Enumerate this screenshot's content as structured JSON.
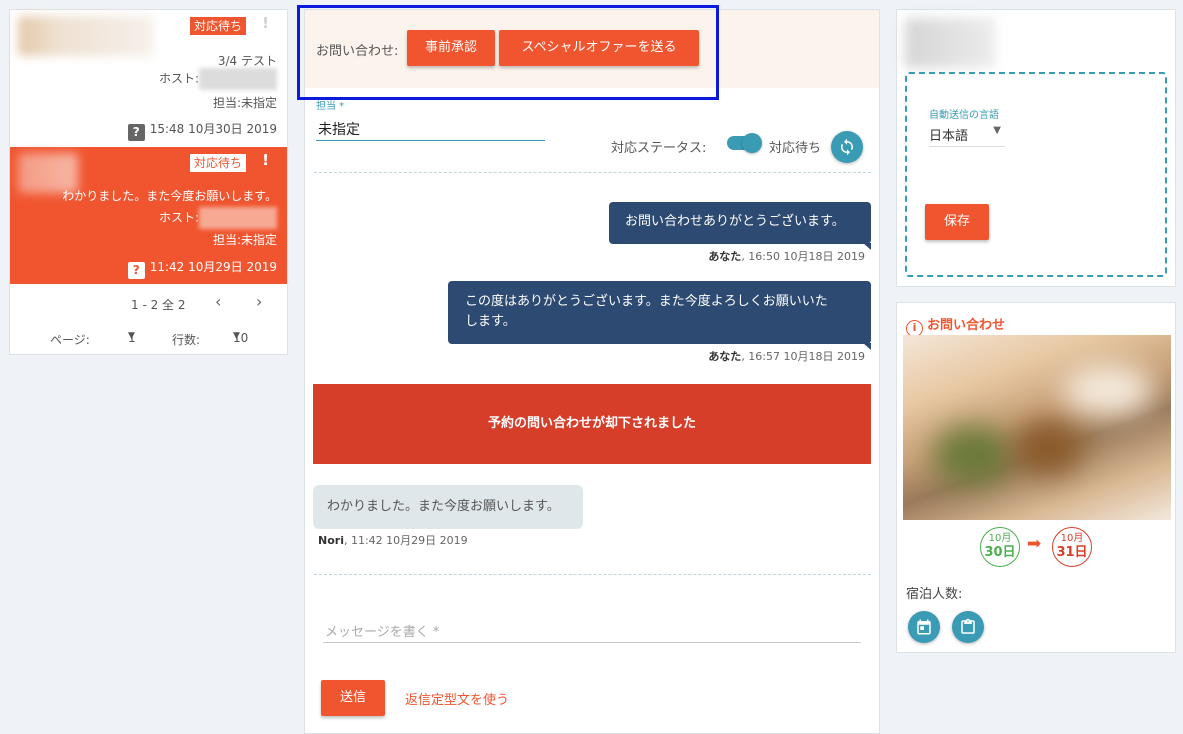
{
  "conversations": [
    {
      "badge": "対応待ち",
      "message": "3/4 テスト",
      "host_label": "ホスト:",
      "assignee": "担当:未指定",
      "question_icon": "?",
      "timestamp": "15:48 10月30日 2019"
    },
    {
      "badge": "対応待ち",
      "message": "わかりました。また今度お願いします。",
      "host_label": "ホスト:",
      "assignee": "担当:未指定",
      "question_icon": "?",
      "timestamp": "11:42 10月29日 2019"
    }
  ],
  "pager": {
    "range": "1 - 2 全 2",
    "page_label": "ページ:",
    "page_value": "1",
    "rows_label": "行数:",
    "rows_value": "10"
  },
  "inquiry_bar": {
    "label": "お問い合わせ:",
    "preapprove": "事前承認",
    "special_offer": "スペシャルオファーを送る"
  },
  "assign": {
    "label": "担当 *",
    "value": "未指定"
  },
  "status": {
    "label": "対応ステータス:",
    "value": "対応待ち"
  },
  "messages": [
    {
      "text": "お問い合わせありがとうございます。",
      "sender": "あなた",
      "time": ", 16:50 10月18日 2019"
    },
    {
      "text_line1": "この度はありがとうございます。また今度よろしくお願いいた",
      "text_line2": "します。",
      "sender": "あなた",
      "time": ", 16:57 10月18日 2019"
    }
  ],
  "declined_banner": "予約の問い合わせが却下されました",
  "guest_message": {
    "text": "わかりました。また今度お願いします。",
    "sender": "Nori",
    "time": ", 11:42 10月29日 2019"
  },
  "compose": {
    "placeholder": "メッセージを書く *",
    "send": "送信",
    "template_link": "返信定型文を使う"
  },
  "auto_reply": {
    "label": "自動送信の言語",
    "language": "日本語",
    "save": "保存"
  },
  "inquiry_card": {
    "title": "お問い合わせ",
    "checkin_month": "10月",
    "checkin_day": "30日",
    "checkout_month": "10月",
    "checkout_day": "31日",
    "guests_label": "宿泊人数:"
  },
  "colors": {
    "accent": "#f05530",
    "navy": "#2d4a72",
    "teal": "#3a9bb5",
    "declined": "#d63e2a",
    "highlight_box": "#0b1bdc"
  },
  "icons": {
    "flag": "exclamation-icon",
    "question": "question-icon",
    "sync": "sync-icon",
    "calendar": "calendar-icon",
    "clipboard": "clipboard-icon",
    "info": "info-icon"
  }
}
